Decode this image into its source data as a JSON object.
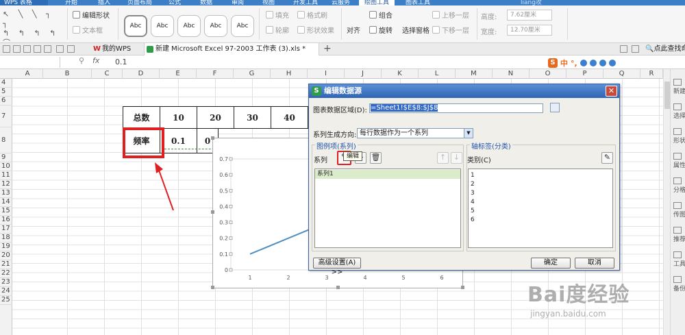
{
  "ribbon_tabs": [
    "WPS 表格",
    "开始",
    "插入",
    "页面布局",
    "公式",
    "数据",
    "审阅",
    "视图",
    "开发工具",
    "云服务",
    "绘图工具",
    "图表工具"
  ],
  "active_tab": "绘图工具",
  "user": "liang攻",
  "ribbon": {
    "edit_shape": "编辑形状",
    "text_box": "文本框",
    "style_samples": [
      "Abc",
      "Abc",
      "Abc",
      "Abc",
      "Abc"
    ],
    "fill": "填充",
    "format_painter": "格式刷",
    "outline": "轮廓",
    "shape_effects": "形状效果",
    "align": "对齐",
    "group": "组合",
    "rotate": "旋转",
    "selection_pane": "选择窗格",
    "bring_forward": "上移一层",
    "send_backward": "下移一层",
    "height_label": "高度:",
    "height_value": "7.62厘米",
    "width_label": "宽度:",
    "width_value": "12.70厘米"
  },
  "docbar": {
    "tab_mywps": "我的WPS",
    "tab_file": "新建 Microsoft Excel 97-2003 工作表 (3).xls *",
    "search": "点此查找命"
  },
  "formula_bar": {
    "fx": "fx",
    "value": "0.1"
  },
  "ime": {
    "s": "S",
    "zh": "中",
    "punct": "°,"
  },
  "columns": [
    "A",
    "B",
    "C",
    "D",
    "E",
    "F",
    "G",
    "H",
    "I",
    "J",
    "K",
    "L",
    "M",
    "N",
    "O",
    "P",
    "Q",
    "R"
  ],
  "rows": [
    "4",
    "5",
    "6",
    "7",
    "8",
    "9",
    "10",
    "11",
    "12",
    "13",
    "14",
    "15",
    "16",
    "17",
    "18",
    "19",
    "20",
    "21",
    "22",
    "23",
    "24",
    "25"
  ],
  "table": {
    "row1": [
      "总数",
      "10",
      "20",
      "30",
      "40"
    ],
    "row2": [
      "频率",
      "0.1",
      "0"
    ]
  },
  "chart_data": {
    "type": "line",
    "categories": [
      "1",
      "2",
      "3",
      "4",
      "5",
      "6"
    ],
    "series": [
      {
        "values": [
          0.1,
          0.2,
          0.3
        ]
      }
    ],
    "yticks": [
      "0.7",
      "0.6",
      "0.5",
      "0.4",
      "0.3",
      "0.2",
      "0.1",
      "0"
    ],
    "ylim": [
      0,
      0.7
    ],
    "color": "#4f8fc0"
  },
  "dialog": {
    "title": "编辑数据源",
    "data_range_label": "图表数据区域(D):",
    "data_range_value": "=Sheet1!$E$8:$J$8",
    "series_direction_label": "系列生成方向:",
    "series_direction_value": "每行数据作为一个系列",
    "legend_group_title": "图例项(系列)",
    "axis_group_title": "轴标签(分类)",
    "series_label": "系列",
    "category_label": "类别(C)",
    "series_items": [
      "系列1"
    ],
    "category_items": [
      "1",
      "2",
      "3",
      "4",
      "5",
      "6"
    ],
    "tooltip": "编辑",
    "advanced_button": "高级设置(A) >>",
    "ok_button": "确定",
    "cancel_button": "取消"
  },
  "side_panel": [
    "新建",
    "选择",
    "形状",
    "属性",
    "分格",
    "传图",
    "推荐",
    "工具",
    "备份"
  ],
  "watermark": {
    "main": "Bai度经验",
    "sub": "jingyan.baidu.com"
  },
  "colors": {
    "ribbon_blue": "#3c7fc7",
    "highlight_red": "#e02020",
    "dialog_title": "#2f64b5"
  }
}
